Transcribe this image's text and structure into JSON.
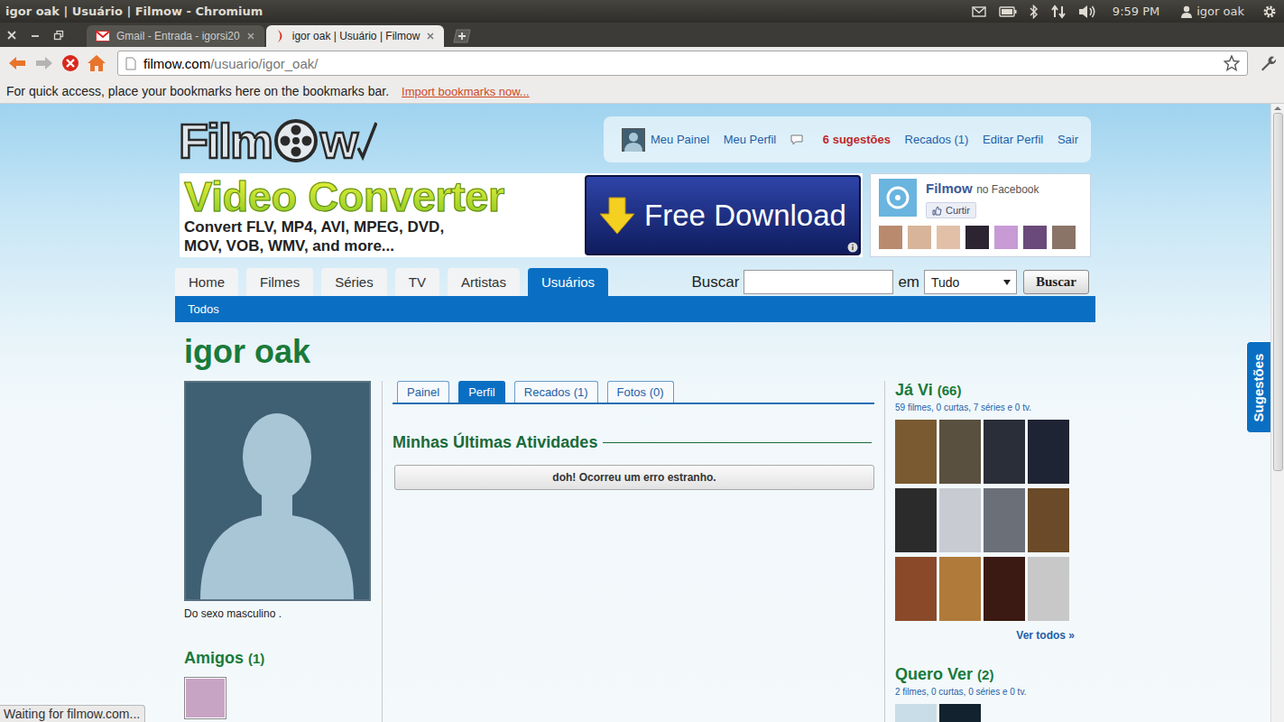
{
  "system_panel": {
    "title": "igor oak | Usuário | Filmow - Chromium",
    "clock": "9:59 PM",
    "user": "igor oak"
  },
  "browser": {
    "tabs": [
      {
        "label": "Gmail - Entrada - igorsi20",
        "selected": false
      },
      {
        "label": "igor oak | Usuário | Filmow",
        "selected": true
      }
    ],
    "url": {
      "host": "filmow.com",
      "path": "/usuario/igor_oak/"
    },
    "bookmarks_bar": {
      "hint": "For quick access, place your bookmarks here on the bookmarks bar.",
      "link": "Import bookmarks now..."
    },
    "status": "Waiting for filmow.com..."
  },
  "header": {
    "logo": {
      "start": "Film",
      "end": "w"
    },
    "user_menu": [
      {
        "label": "Meu Painel",
        "kind": "avatar"
      },
      {
        "label": "Meu Perfil",
        "kind": "link"
      },
      {
        "label": "6 sugestões",
        "kind": "alert"
      },
      {
        "label": "Recados (1)",
        "kind": "link"
      },
      {
        "label": "Editar Perfil",
        "kind": "link"
      },
      {
        "label": "Sair",
        "kind": "link"
      }
    ]
  },
  "ad": {
    "headline": "Video Converter",
    "lines": [
      "Convert FLV, MP4, AVI, MPEG, DVD,",
      "MOV, VOB, WMV, and more..."
    ],
    "button": "Free Download"
  },
  "facebook": {
    "name": "Filmow",
    "suffix": "no Facebook",
    "like": "Curtir",
    "faces": [
      {
        "color": "#b98a6e"
      },
      {
        "color": "#d8b59a"
      },
      {
        "color": "#e2c0a8"
      },
      {
        "color": "#2c2430"
      },
      {
        "color": "#c79ad6"
      },
      {
        "color": "#6a4a7a"
      },
      {
        "color": "#8a7468"
      }
    ]
  },
  "nav": {
    "tabs": [
      {
        "label": "Home",
        "selected": false
      },
      {
        "label": "Filmes",
        "selected": false
      },
      {
        "label": "Séries",
        "selected": false
      },
      {
        "label": "TV",
        "selected": false
      },
      {
        "label": "Artistas",
        "selected": false
      },
      {
        "label": "Usuários",
        "selected": true
      }
    ],
    "sub_nav": [
      "Todos"
    ],
    "search": {
      "label": "Buscar",
      "in": "em",
      "scope": "Tudo",
      "button": "Buscar"
    }
  },
  "profile": {
    "name": "igor oak",
    "gender": "Do sexo masculino .",
    "friends": {
      "title": "Amigos",
      "count": "(1)",
      "items": [
        {
          "color": "#c8a4c4"
        }
      ]
    },
    "tabs": [
      {
        "label": "Painel",
        "selected": false
      },
      {
        "label": "Perfil",
        "selected": true
      },
      {
        "label": "Recados (1)",
        "selected": false
      },
      {
        "label": "Fotos (0)",
        "selected": false
      }
    ],
    "activities": {
      "title": "Minhas Últimas Atividades",
      "error": "doh! Ocorreu um erro estranho."
    },
    "seen": {
      "title": "Já Vi",
      "count": "(66)",
      "summary": "59 filmes, 0 curtas, 7 séries e 0 tv.",
      "posters": [
        {
          "color": "#7a5a30"
        },
        {
          "color": "#5a5040"
        },
        {
          "color": "#2a2e38"
        },
        {
          "color": "#1e2433"
        },
        {
          "color": "#2b2b2b"
        },
        {
          "color": "#c8ccd2"
        },
        {
          "color": "#6a6f78"
        },
        {
          "color": "#6a4a28"
        },
        {
          "color": "#8a4a2a"
        },
        {
          "color": "#b07a3a"
        },
        {
          "color": "#3a1a12"
        },
        {
          "color": "#c8c8c8"
        }
      ],
      "more": "Ver todos »"
    },
    "want": {
      "title": "Quero Ver",
      "count": "(2)",
      "summary": "2 filmes, 0 curtas, 0 séries e 0 tv.",
      "posters": [
        {
          "color": "#c9dde8"
        },
        {
          "color": "#12222e"
        }
      ]
    }
  },
  "side_tab": "Sugestões"
}
